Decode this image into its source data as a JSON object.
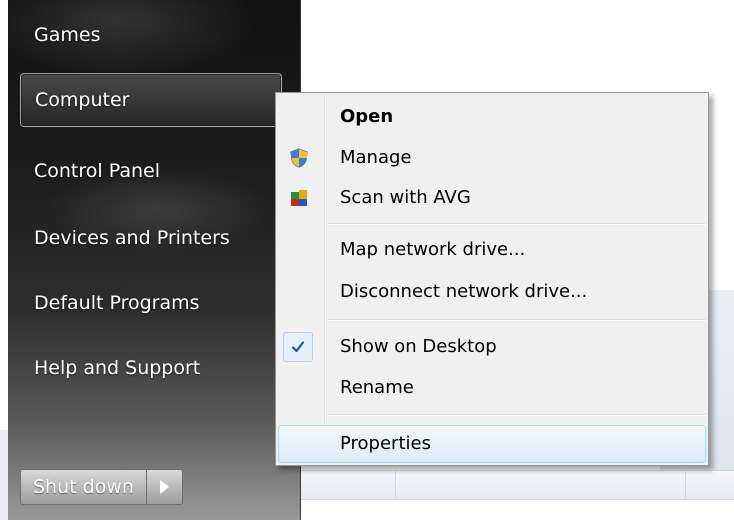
{
  "start_menu": {
    "items": [
      {
        "label": "Games"
      },
      {
        "label": "Computer"
      },
      {
        "label": "Control Panel"
      },
      {
        "label": "Devices and Printers"
      },
      {
        "label": "Default Programs"
      },
      {
        "label": "Help and Support"
      }
    ],
    "shutdown_label": "Shut down"
  },
  "context_menu": {
    "items": [
      {
        "label": "Open",
        "bold": true
      },
      {
        "label": "Manage",
        "icon": "shield-icon"
      },
      {
        "label": "Scan with AVG",
        "icon": "avg-icon"
      },
      {
        "label": "Map network drive..."
      },
      {
        "label": "Disconnect network drive..."
      },
      {
        "label": "Show on Desktop",
        "checked": true
      },
      {
        "label": "Rename"
      },
      {
        "label": "Properties",
        "highlighted": true
      }
    ]
  },
  "colors": {
    "menu_background": "#f0f0f0",
    "highlight_border": "#a8d8eb",
    "check_color": "#1a57b5"
  }
}
